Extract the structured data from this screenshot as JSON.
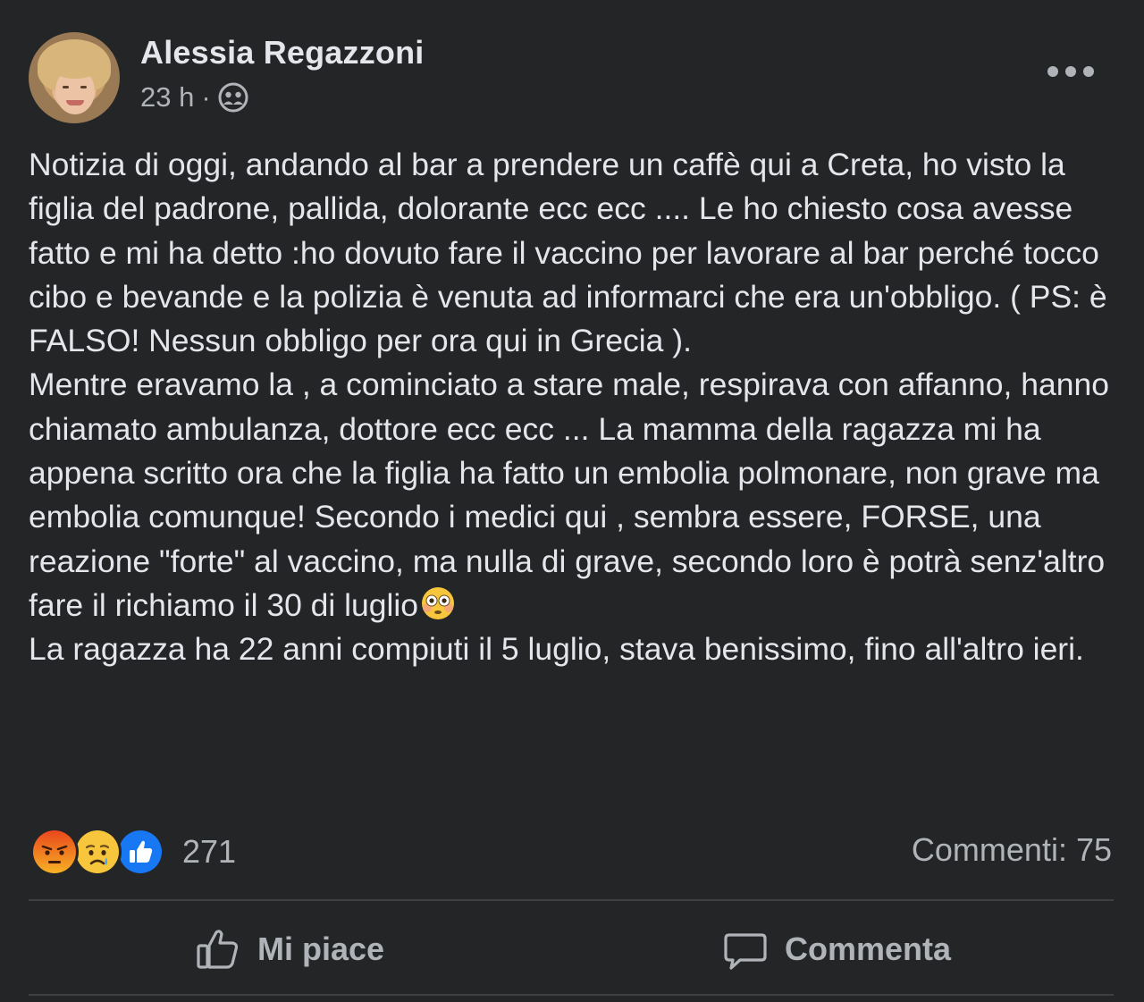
{
  "author": {
    "name": "Alessia Regazzoni",
    "time": "23 h",
    "separator": "·",
    "audience_icon": "friends-icon"
  },
  "post": {
    "paragraphs": [
      "Notizia di oggi, andando al bar a prendere un caffè qui a Creta, ho visto la figlia del padrone, pallida, dolorante ecc ecc .... Le ho chiesto cosa avesse fatto e mi ha detto :ho dovuto fare il vaccino per lavorare al bar perché tocco cibo e bevande e la polizia è venuta ad informarci che era un'obbligo. ( PS: è FALSO! Nessun obbligo per ora qui in Grecia ).",
      "Mentre eravamo la , a cominciato a stare male, respirava con affanno, hanno chiamato ambulanza, dottore ecc ecc ... La mamma della ragazza mi ha appena scritto ora che la figlia ha fatto un embolia polmonare, non grave ma embolia comunque! Secondo i medici qui , sembra essere, FORSE, una reazione \"forte\" al vaccino, ma nulla di grave, secondo loro è potrà senz'altro fare il richiamo il 30 di luglio",
      "La ragazza ha 22 anni compiuti il 5 luglio, stava benissimo, fino all'altro ieri."
    ],
    "emoji_after_paragraph_2": "flushed-face-emoji"
  },
  "engagement": {
    "reaction_icons": [
      "angry-reaction-icon",
      "sad-reaction-icon",
      "like-reaction-icon"
    ],
    "reaction_count": "271",
    "comments_label": "Commenti: 75"
  },
  "actions": {
    "like_label": "Mi piace",
    "comment_label": "Commenta"
  },
  "colors": {
    "background": "#242526",
    "primary_text": "#e4e6eb",
    "secondary_text": "#b0b3b8",
    "like_blue": "#1877f2",
    "angry_orange": "#e9710f"
  }
}
